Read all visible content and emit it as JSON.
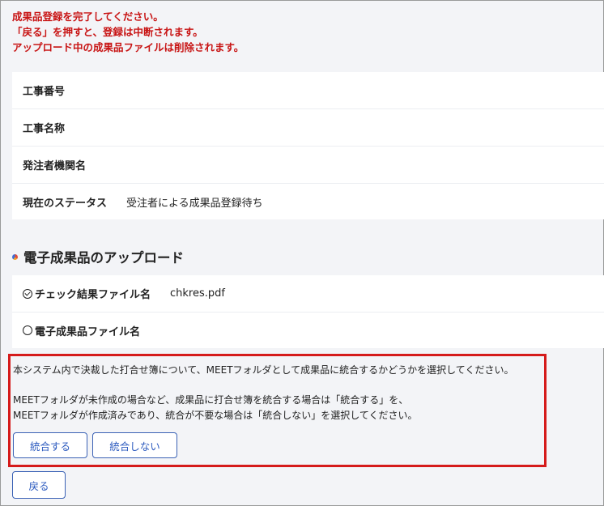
{
  "warning": {
    "line1": "成果品登録を完了してください。",
    "line2": "「戻る」を押すと、登録は中断されます。",
    "line3": "アップロード中の成果品ファイルは削除されます。"
  },
  "info": {
    "rows": [
      {
        "label": "工事番号",
        "value": ""
      },
      {
        "label": "工事名称",
        "value": ""
      },
      {
        "label": "発注者機関名",
        "value": ""
      },
      {
        "label": "現在のステータス",
        "value": "受注者による成果品登録待ち"
      }
    ]
  },
  "upload": {
    "title": "電子成果品のアップロード",
    "rows": [
      {
        "label": "チェック結果ファイル名",
        "value": "chkres.pdf",
        "status_icon": "check-circle-icon"
      },
      {
        "label": "電子成果品ファイル名",
        "value": "",
        "status_icon": "empty-circle-icon"
      }
    ]
  },
  "merge": {
    "text1": "本システム内で決裁した打合せ簿について、MEETフォルダとして成果品に統合するかどうかを選択してください。",
    "text2": "MEETフォルダが未作成の場合など、成果品に打合せ簿を統合する場合は「統合する」を、",
    "text3": "MEETフォルダが作成済みであり、統合が不要な場合は「統合しない」を選択してください。",
    "integrate_label": "統合する",
    "no_integrate_label": "統合しない"
  },
  "back_label": "戻る",
  "colors": {
    "warning": "#c81414",
    "highlight_border": "#d51b1b",
    "button_text": "#2d5bbf"
  }
}
